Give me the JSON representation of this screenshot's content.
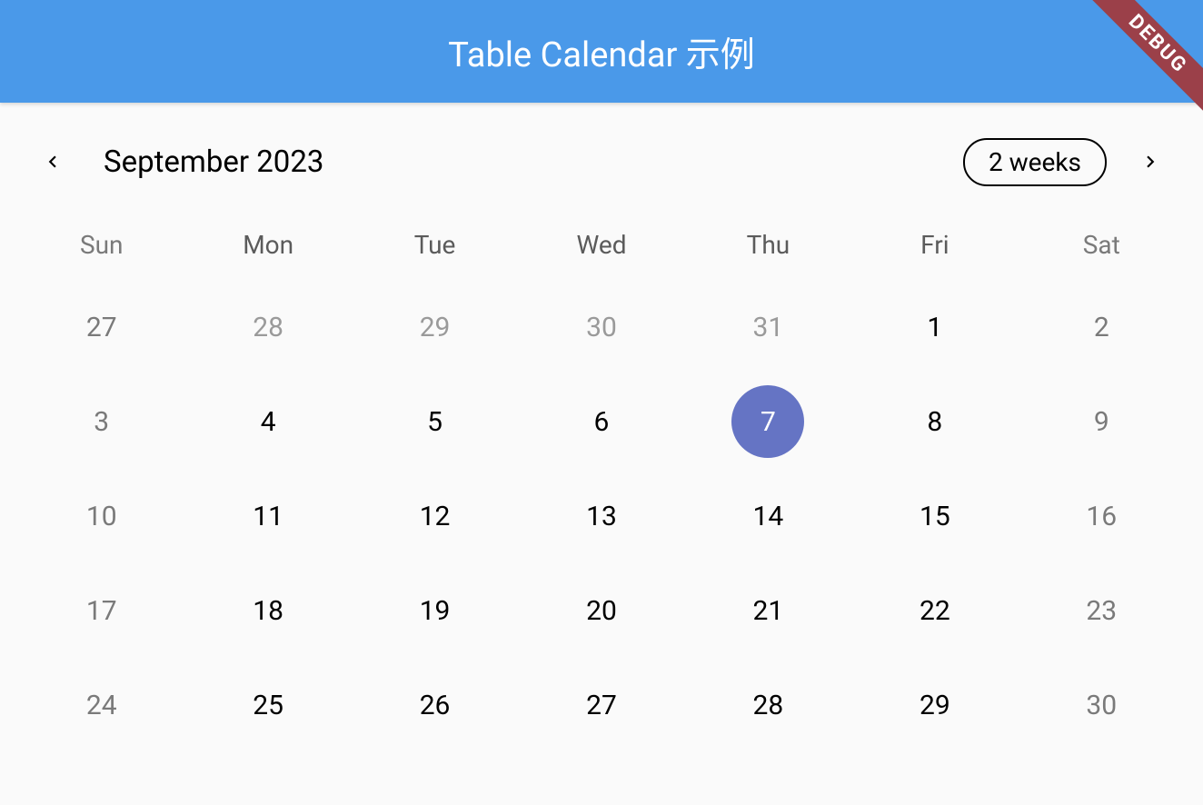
{
  "app_bar": {
    "title": "Table Calendar 示例"
  },
  "debug_banner": "DEBUG",
  "calendar": {
    "month_title": "September 2023",
    "format_label": "2 weeks",
    "weekdays": [
      "Sun",
      "Mon",
      "Tue",
      "Wed",
      "Thu",
      "Fri",
      "Sat"
    ],
    "weeks": [
      [
        {
          "day": 27,
          "outside": true,
          "weekend": true,
          "today": false
        },
        {
          "day": 28,
          "outside": true,
          "weekend": false,
          "today": false
        },
        {
          "day": 29,
          "outside": true,
          "weekend": false,
          "today": false
        },
        {
          "day": 30,
          "outside": true,
          "weekend": false,
          "today": false
        },
        {
          "day": 31,
          "outside": true,
          "weekend": false,
          "today": false
        },
        {
          "day": 1,
          "outside": false,
          "weekend": false,
          "today": false
        },
        {
          "day": 2,
          "outside": false,
          "weekend": true,
          "today": false
        }
      ],
      [
        {
          "day": 3,
          "outside": false,
          "weekend": true,
          "today": false
        },
        {
          "day": 4,
          "outside": false,
          "weekend": false,
          "today": false
        },
        {
          "day": 5,
          "outside": false,
          "weekend": false,
          "today": false
        },
        {
          "day": 6,
          "outside": false,
          "weekend": false,
          "today": false
        },
        {
          "day": 7,
          "outside": false,
          "weekend": false,
          "today": true
        },
        {
          "day": 8,
          "outside": false,
          "weekend": false,
          "today": false
        },
        {
          "day": 9,
          "outside": false,
          "weekend": true,
          "today": false
        }
      ],
      [
        {
          "day": 10,
          "outside": false,
          "weekend": true,
          "today": false
        },
        {
          "day": 11,
          "outside": false,
          "weekend": false,
          "today": false
        },
        {
          "day": 12,
          "outside": false,
          "weekend": false,
          "today": false
        },
        {
          "day": 13,
          "outside": false,
          "weekend": false,
          "today": false
        },
        {
          "day": 14,
          "outside": false,
          "weekend": false,
          "today": false
        },
        {
          "day": 15,
          "outside": false,
          "weekend": false,
          "today": false
        },
        {
          "day": 16,
          "outside": false,
          "weekend": true,
          "today": false
        }
      ],
      [
        {
          "day": 17,
          "outside": false,
          "weekend": true,
          "today": false
        },
        {
          "day": 18,
          "outside": false,
          "weekend": false,
          "today": false
        },
        {
          "day": 19,
          "outside": false,
          "weekend": false,
          "today": false
        },
        {
          "day": 20,
          "outside": false,
          "weekend": false,
          "today": false
        },
        {
          "day": 21,
          "outside": false,
          "weekend": false,
          "today": false
        },
        {
          "day": 22,
          "outside": false,
          "weekend": false,
          "today": false
        },
        {
          "day": 23,
          "outside": false,
          "weekend": true,
          "today": false
        }
      ],
      [
        {
          "day": 24,
          "outside": false,
          "weekend": true,
          "today": false
        },
        {
          "day": 25,
          "outside": false,
          "weekend": false,
          "today": false
        },
        {
          "day": 26,
          "outside": false,
          "weekend": false,
          "today": false
        },
        {
          "day": 27,
          "outside": false,
          "weekend": false,
          "today": false
        },
        {
          "day": 28,
          "outside": false,
          "weekend": false,
          "today": false
        },
        {
          "day": 29,
          "outside": false,
          "weekend": false,
          "today": false
        },
        {
          "day": 30,
          "outside": false,
          "weekend": true,
          "today": false
        }
      ]
    ]
  }
}
